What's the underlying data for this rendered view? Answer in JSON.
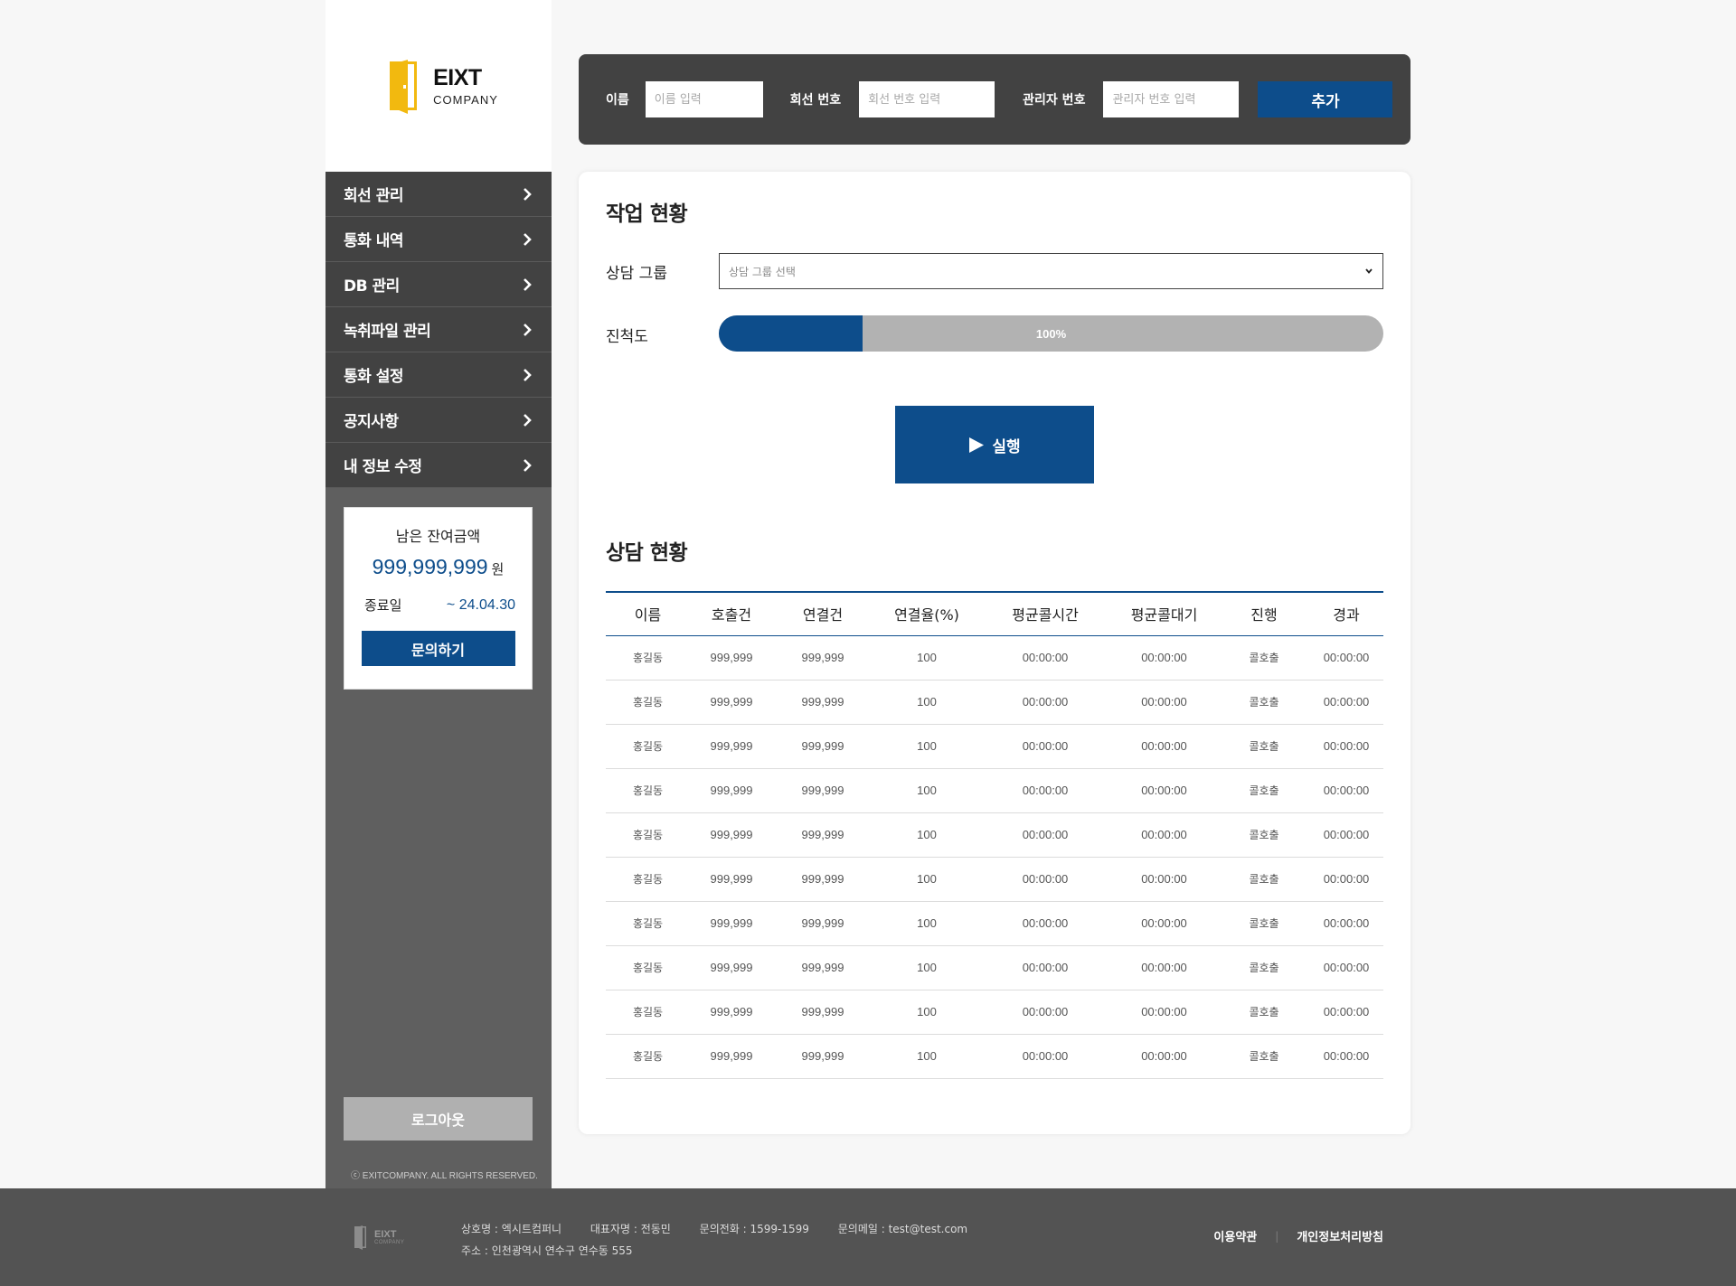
{
  "brand": {
    "name": "EIXT",
    "sub": "COMPANY",
    "accent": "#f2b90f",
    "primary": "#0d4d8b"
  },
  "sidebar": {
    "items": [
      {
        "label": "회선 관리"
      },
      {
        "label": "통화 내역"
      },
      {
        "label": "DB 관리"
      },
      {
        "label": "녹취파일 관리"
      },
      {
        "label": "통화 설정"
      },
      {
        "label": "공지사항"
      },
      {
        "label": "내 정보 수정"
      }
    ],
    "balance": {
      "title": "남은 잔여금액",
      "amount": "999,999,999",
      "unit": "원",
      "end_label": "종료일",
      "end_value": "~ 24.04.30",
      "inquiry_label": "문의하기"
    },
    "logout_label": "로그아웃",
    "copyright": "ⓒ EXITCOMPANY. ALL RIGHTS RESERVED."
  },
  "add_form": {
    "name_label": "이름",
    "name_placeholder": "이름 입력",
    "line_label": "회선 번호",
    "line_placeholder": "회선 번호 입력",
    "admin_label": "관리자 번호",
    "admin_placeholder": "관리자 번호 입력",
    "add_label": "추가"
  },
  "work": {
    "title": "작업 현황",
    "group_label": "상담 그룹",
    "group_placeholder": "상담 그룹 선택",
    "progress_label": "진척도",
    "progress_text": "100%",
    "progress_fill_fraction": 0.217,
    "run_label": "실행"
  },
  "consult": {
    "title": "상담 현황",
    "columns": [
      "이름",
      "호출건",
      "연결건",
      "연결율(%)",
      "평균콜시간",
      "평균콜대기",
      "진행",
      "경과"
    ],
    "rows": [
      [
        "홍길동",
        "999,999",
        "999,999",
        "100",
        "00:00:00",
        "00:00:00",
        "콜호출",
        "00:00:00"
      ],
      [
        "홍길동",
        "999,999",
        "999,999",
        "100",
        "00:00:00",
        "00:00:00",
        "콜호출",
        "00:00:00"
      ],
      [
        "홍길동",
        "999,999",
        "999,999",
        "100",
        "00:00:00",
        "00:00:00",
        "콜호출",
        "00:00:00"
      ],
      [
        "홍길동",
        "999,999",
        "999,999",
        "100",
        "00:00:00",
        "00:00:00",
        "콜호출",
        "00:00:00"
      ],
      [
        "홍길동",
        "999,999",
        "999,999",
        "100",
        "00:00:00",
        "00:00:00",
        "콜호출",
        "00:00:00"
      ],
      [
        "홍길동",
        "999,999",
        "999,999",
        "100",
        "00:00:00",
        "00:00:00",
        "콜호출",
        "00:00:00"
      ],
      [
        "홍길동",
        "999,999",
        "999,999",
        "100",
        "00:00:00",
        "00:00:00",
        "콜호출",
        "00:00:00"
      ],
      [
        "홍길동",
        "999,999",
        "999,999",
        "100",
        "00:00:00",
        "00:00:00",
        "콜호출",
        "00:00:00"
      ],
      [
        "홍길동",
        "999,999",
        "999,999",
        "100",
        "00:00:00",
        "00:00:00",
        "콜호출",
        "00:00:00"
      ],
      [
        "홍길동",
        "999,999",
        "999,999",
        "100",
        "00:00:00",
        "00:00:00",
        "콜호출",
        "00:00:00"
      ]
    ]
  },
  "footer": {
    "logo_name": "EIXT",
    "logo_sub": "COMPANY",
    "company": "상호명 : 엑시트컴퍼니",
    "ceo": "대표자명 : 전동민",
    "phone": "문의전화 : 1599-1599",
    "email": "문의메일 : test@test.com",
    "address": "주소 : 인천광역시 연수구 연수동 555",
    "terms_label": "이용약관",
    "separator": "|",
    "privacy_label": "개인정보처리방침"
  }
}
